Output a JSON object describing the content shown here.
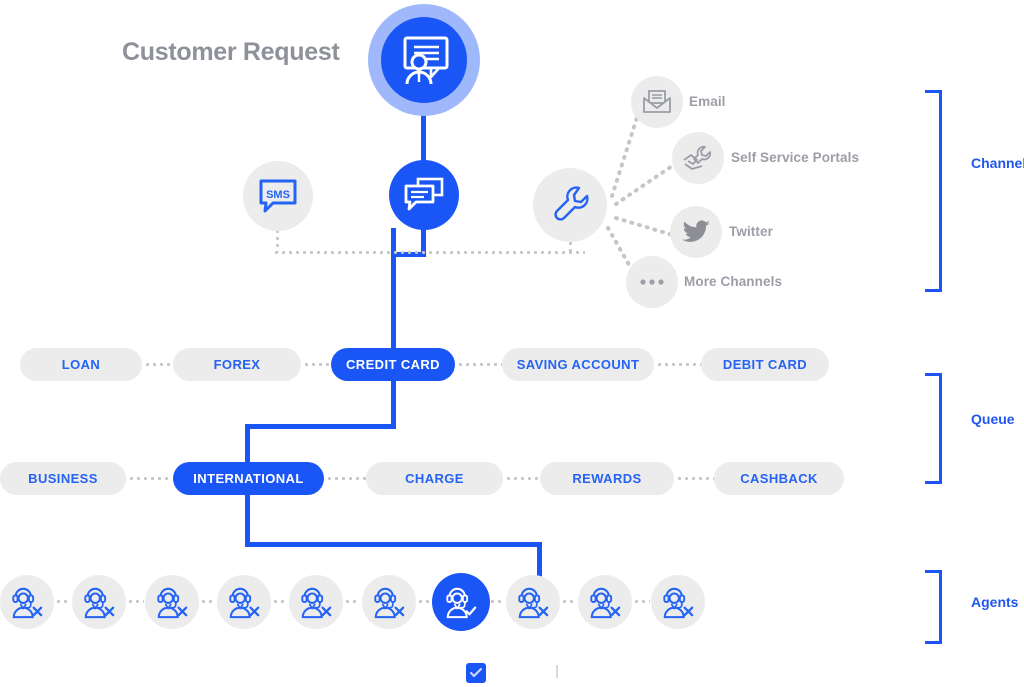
{
  "diagram": {
    "title": "Customer Request",
    "root_node": {
      "icon": "presentation-agent-icon",
      "state": "active"
    }
  },
  "entry_nodes": [
    {
      "id": "sms",
      "icon": "sms-bubble-icon",
      "label": "SMS",
      "state": "inactive"
    },
    {
      "id": "chat",
      "icon": "chat-bubbles-icon",
      "label": "",
      "state": "active"
    },
    {
      "id": "hub",
      "icon": "wrench-icon",
      "label": "",
      "state": "inactive"
    }
  ],
  "channels": {
    "group_label": "Channels",
    "items": [
      {
        "label": "Email",
        "icon": "envelope-icon"
      },
      {
        "label": "Self Service Portals",
        "icon": "handshake-wrench-icon"
      },
      {
        "label": "Twitter",
        "icon": "twitter-bird-icon"
      },
      {
        "label": "More Channels",
        "icon": "ellipsis-icon"
      }
    ]
  },
  "queue": {
    "group_label": "Queue",
    "row1": [
      {
        "label": "LOAN",
        "state": "inactive"
      },
      {
        "label": "FOREX",
        "state": "inactive"
      },
      {
        "label": "CREDIT CARD",
        "state": "active"
      },
      {
        "label": "SAVING ACCOUNT",
        "state": "inactive"
      },
      {
        "label": "DEBIT CARD",
        "state": "inactive"
      }
    ],
    "row2": [
      {
        "label": "BUSINESS",
        "state": "inactive"
      },
      {
        "label": "INTERNATIONAL",
        "state": "active"
      },
      {
        "label": "CHARGE",
        "state": "inactive"
      },
      {
        "label": "REWARDS",
        "state": "inactive"
      },
      {
        "label": "CASHBACK",
        "state": "inactive"
      }
    ]
  },
  "agents": {
    "group_label": "Agents",
    "items": [
      {
        "icon": "agent-unavailable-icon",
        "state": "unavailable"
      },
      {
        "icon": "agent-unavailable-icon",
        "state": "unavailable"
      },
      {
        "icon": "agent-unavailable-icon",
        "state": "unavailable"
      },
      {
        "icon": "agent-unavailable-icon",
        "state": "unavailable"
      },
      {
        "icon": "agent-unavailable-icon",
        "state": "unavailable"
      },
      {
        "icon": "agent-unavailable-icon",
        "state": "unavailable"
      },
      {
        "icon": "agent-available-icon",
        "state": "selected"
      },
      {
        "icon": "agent-unavailable-icon",
        "state": "unavailable"
      },
      {
        "icon": "agent-unavailable-icon",
        "state": "unavailable"
      },
      {
        "icon": "agent-unavailable-icon",
        "state": "unavailable"
      }
    ]
  },
  "colors": {
    "accent_blue": "#1a56f5",
    "accent_blue_text": "#2563f5",
    "halo_blue": "#9fb8fb",
    "node_grey": "#ececec",
    "label_grey": "#9b9ea6",
    "title_grey": "#8e9199",
    "dot_grey": "#c6c6c6"
  }
}
